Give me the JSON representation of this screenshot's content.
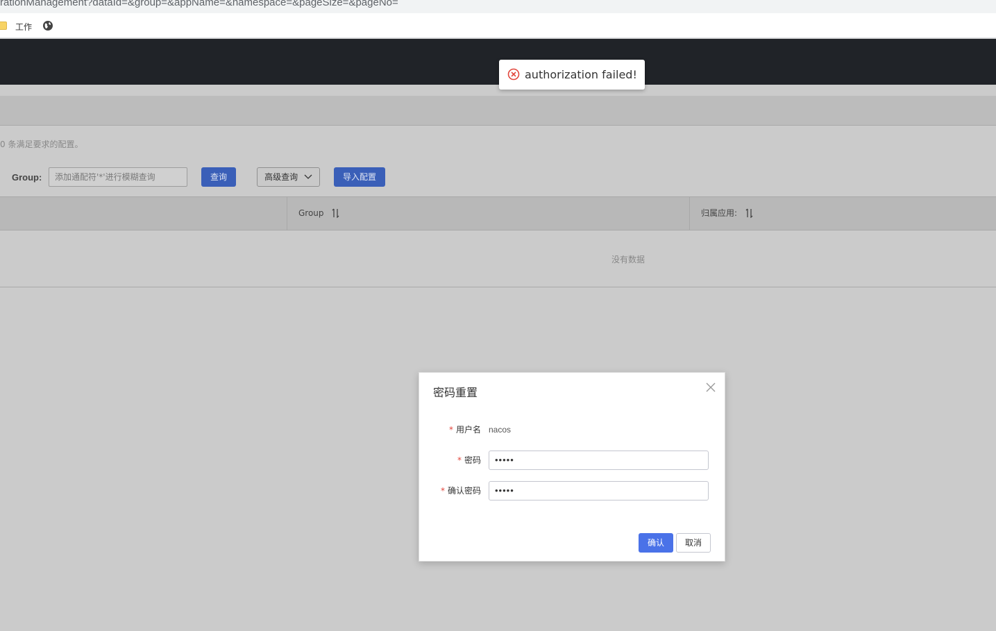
{
  "browser": {
    "url": "rationManagement?dataId=&group=&appName=&namespace=&pageSize=&pageNo=",
    "bookmark_label": "工作"
  },
  "toast": {
    "message": "authorization failed!",
    "icon": "error-circle-icon"
  },
  "page": {
    "result_text": "0 条满足要求的配置。",
    "group_label": "Group:",
    "group_placeholder": "添加通配符'*'进行模糊查询",
    "query_button": "查询",
    "advanced_button": "高级查询",
    "import_button": "导入配置",
    "table": {
      "columns": [
        "Group",
        "归属应用:"
      ],
      "empty_text": "没有数据"
    }
  },
  "dialog": {
    "title": "密码重置",
    "fields": {
      "username_label": "用户名",
      "username_value": "nacos",
      "password_label": "密码",
      "password_value": "•••••",
      "confirm_label": "确认密码",
      "confirm_value": "•••••"
    },
    "ok_button": "确认",
    "cancel_button": "取消"
  },
  "colors": {
    "header_bg": "#202328",
    "primary": "#4a72e8",
    "error": "#e2463c"
  }
}
